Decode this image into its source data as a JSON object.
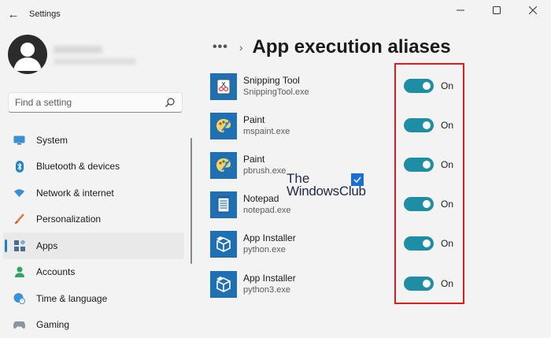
{
  "window": {
    "title": "Settings",
    "back_icon": "back-arrow-icon"
  },
  "search": {
    "placeholder": "Find a setting"
  },
  "nav": {
    "items": [
      {
        "label": "System",
        "icon": "system-icon"
      },
      {
        "label": "Bluetooth & devices",
        "icon": "bluetooth-icon"
      },
      {
        "label": "Network & internet",
        "icon": "wifi-icon"
      },
      {
        "label": "Personalization",
        "icon": "brush-icon"
      },
      {
        "label": "Apps",
        "icon": "apps-icon",
        "selected": true
      },
      {
        "label": "Accounts",
        "icon": "person-icon"
      },
      {
        "label": "Time & language",
        "icon": "globe-clock-icon"
      },
      {
        "label": "Gaming",
        "icon": "gamepad-icon"
      }
    ]
  },
  "header": {
    "more": "•••",
    "chevron": "›",
    "title": "App execution aliases"
  },
  "aliases": [
    {
      "name": "Snipping Tool",
      "exe": "SnippingTool.exe",
      "state": "On",
      "icon": "snipping-tool-icon"
    },
    {
      "name": "Paint",
      "exe": "mspaint.exe",
      "state": "On",
      "icon": "paint-icon"
    },
    {
      "name": "Paint",
      "exe": "pbrush.exe",
      "state": "On",
      "icon": "paint-icon"
    },
    {
      "name": "Notepad",
      "exe": "notepad.exe",
      "state": "On",
      "icon": "notepad-icon"
    },
    {
      "name": "App Installer",
      "exe": "python.exe",
      "state": "On",
      "icon": "app-installer-icon"
    },
    {
      "name": "App Installer",
      "exe": "python3.exe",
      "state": "On",
      "icon": "app-installer-icon"
    }
  ],
  "watermark": {
    "line1": "The",
    "line2": "WindowsClub"
  },
  "colors": {
    "accent": "#1e8ea4",
    "app_tile": "#1f6fb5",
    "highlight": "#e21b1b",
    "selection_indicator": "#1f7fc4"
  }
}
